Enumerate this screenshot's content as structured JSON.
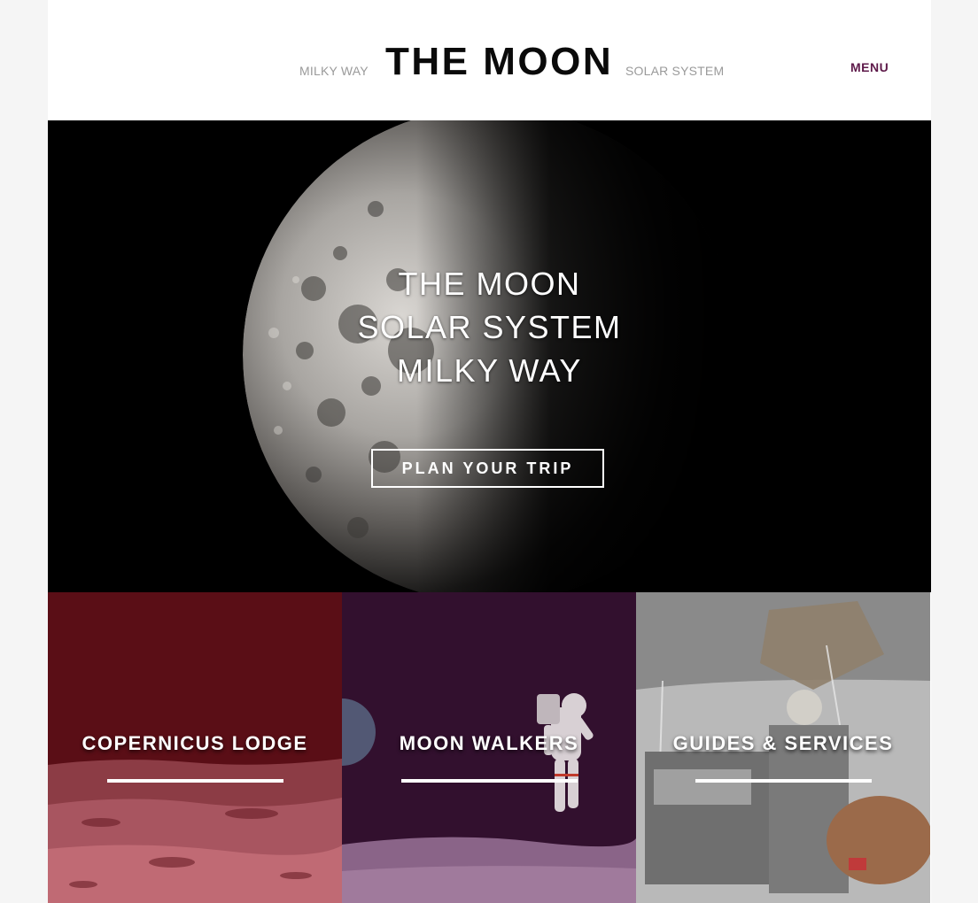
{
  "header": {
    "title": "THE MOON",
    "nav_left": "MILKY WAY",
    "nav_right": "SOLAR SYSTEM",
    "menu_label": "MENU",
    "menu_color": "#5e1a4a"
  },
  "hero": {
    "lines": [
      "THE MOON",
      "SOLAR SYSTEM",
      "MILKY WAY"
    ],
    "cta_label": "PLAN YOUR TRIP"
  },
  "tiles": [
    {
      "label": "COPERNICUS LODGE",
      "color": "#5a0e16"
    },
    {
      "label": "MOON WALKERS",
      "color": "#32102e"
    },
    {
      "label": "GUIDES & SERVICES",
      "color": "#8a8a8a"
    }
  ],
  "icons": {
    "moon": "moon-image",
    "tile_1": "lunar-surface-image",
    "tile_2": "astronaut-image",
    "tile_3": "lunar-rover-image"
  }
}
